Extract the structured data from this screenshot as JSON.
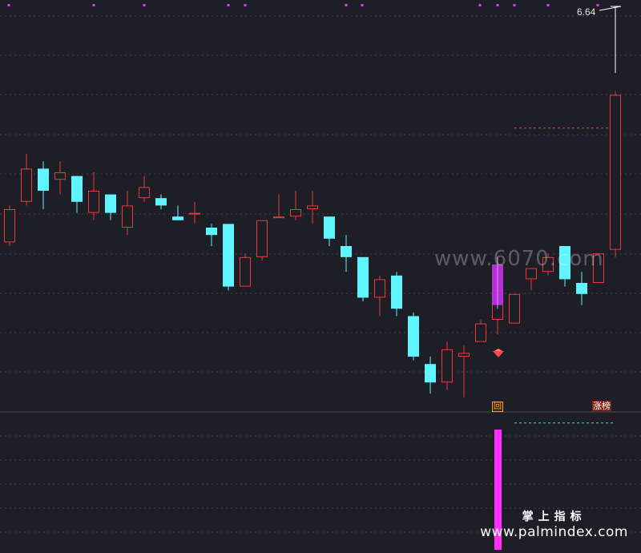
{
  "chart_data": {
    "type": "candlestick",
    "price_axis_max_label": "6.64",
    "tags": {
      "box": "回",
      "zhangbang": "涨榜"
    },
    "candles": [
      {
        "o": 5.51,
        "h": 5.61,
        "l": 5.5,
        "c": 5.6
      },
      {
        "o": 5.62,
        "h": 5.75,
        "l": 5.61,
        "c": 5.71
      },
      {
        "o": 5.71,
        "h": 5.73,
        "l": 5.6,
        "c": 5.65
      },
      {
        "o": 5.68,
        "h": 5.73,
        "l": 5.64,
        "c": 5.7
      },
      {
        "o": 5.69,
        "h": 5.69,
        "l": 5.59,
        "c": 5.62
      },
      {
        "o": 5.59,
        "h": 5.7,
        "l": 5.57,
        "c": 5.65
      },
      {
        "o": 5.64,
        "h": 5.64,
        "l": 5.57,
        "c": 5.59
      },
      {
        "o": 5.55,
        "h": 5.65,
        "l": 5.53,
        "c": 5.61
      },
      {
        "o": 5.63,
        "h": 5.69,
        "l": 5.62,
        "c": 5.66
      },
      {
        "o": 5.63,
        "h": 5.64,
        "l": 5.6,
        "c": 5.61
      },
      {
        "o": 5.58,
        "h": 5.61,
        "l": 5.57,
        "c": 5.57
      },
      {
        "o": 5.59,
        "h": 5.62,
        "l": 5.56,
        "c": 5.59
      },
      {
        "o": 5.55,
        "h": 5.56,
        "l": 5.5,
        "c": 5.53
      },
      {
        "o": 5.56,
        "h": 5.56,
        "l": 5.38,
        "c": 5.39
      },
      {
        "o": 5.39,
        "h": 5.48,
        "l": 5.39,
        "c": 5.47
      },
      {
        "o": 5.47,
        "h": 5.57,
        "l": 5.46,
        "c": 5.57
      },
      {
        "o": 5.58,
        "h": 5.64,
        "l": 5.58,
        "c": 5.58
      },
      {
        "o": 5.58,
        "h": 5.65,
        "l": 5.57,
        "c": 5.6
      },
      {
        "o": 5.6,
        "h": 5.65,
        "l": 5.56,
        "c": 5.61
      },
      {
        "o": 5.58,
        "h": 5.58,
        "l": 5.5,
        "c": 5.52
      },
      {
        "o": 5.5,
        "h": 5.53,
        "l": 5.43,
        "c": 5.47
      },
      {
        "o": 5.47,
        "h": 5.47,
        "l": 5.35,
        "c": 5.36
      },
      {
        "o": 5.36,
        "h": 5.42,
        "l": 5.31,
        "c": 5.41
      },
      {
        "o": 5.42,
        "h": 5.43,
        "l": 5.31,
        "c": 5.33
      },
      {
        "o": 5.31,
        "h": 5.32,
        "l": 5.19,
        "c": 5.2
      },
      {
        "o": 5.18,
        "h": 5.2,
        "l": 5.1,
        "c": 5.13
      },
      {
        "o": 5.13,
        "h": 5.24,
        "l": 5.11,
        "c": 5.22
      },
      {
        "o": 5.2,
        "h": 5.23,
        "l": 5.09,
        "c": 5.21
      },
      {
        "o": 5.24,
        "h": 5.3,
        "l": 5.24,
        "c": 5.29
      },
      {
        "o": 5.3,
        "h": 5.38,
        "l": 5.26,
        "c": 5.38
      },
      {
        "o": 5.29,
        "h": 5.37,
        "l": 5.29,
        "c": 5.37
      },
      {
        "o": 5.41,
        "h": 5.44,
        "l": 5.38,
        "c": 5.44
      },
      {
        "o": 5.43,
        "h": 5.48,
        "l": 5.42,
        "c": 5.47
      },
      {
        "o": 5.5,
        "h": 5.5,
        "l": 5.39,
        "c": 5.41
      },
      {
        "o": 5.4,
        "h": 5.43,
        "l": 5.34,
        "c": 5.37
      },
      {
        "o": 5.4,
        "h": 5.48,
        "l": 5.4,
        "c": 5.48
      },
      {
        "o": 5.49,
        "h": 5.92,
        "l": 5.47,
        "c": 5.91
      }
    ],
    "reference_lines": [
      {
        "value": 5.82,
        "color": "#e83a3a",
        "style": "dashed",
        "from_index": 30,
        "to_index": 36
      },
      {
        "value": 5.02,
        "color": "#3ad8d8",
        "style": "dashed",
        "from_index": 30,
        "to_index": 36
      }
    ],
    "indicator_bar": {
      "index": 29,
      "color": "#ff2dff"
    },
    "colors": {
      "background": "#1d1e26",
      "up": "#e83a3a",
      "down": "#5ff4ff",
      "grid": "#3b3d49",
      "signal": "#c432e8",
      "indicator": "#ff2dff"
    }
  },
  "watermark": "www.6070.com",
  "brand": {
    "cn": "掌上指标",
    "url": "www.palmindex.com"
  }
}
